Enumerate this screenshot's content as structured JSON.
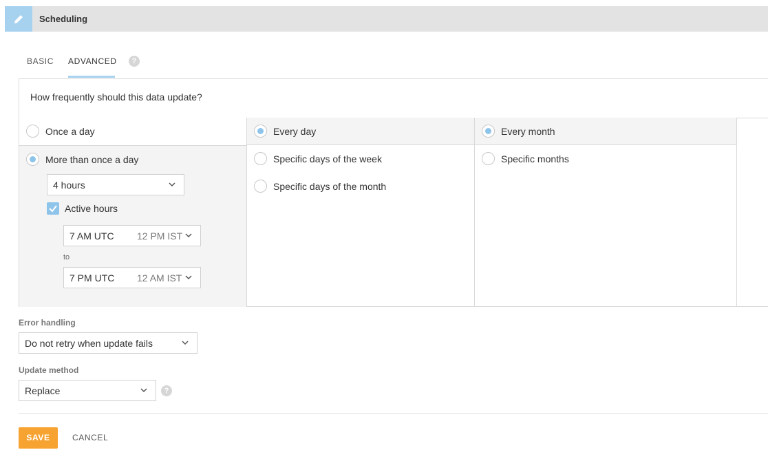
{
  "header": {
    "title": "Scheduling",
    "icon": "pencil-icon",
    "accent": "#a7d2ef"
  },
  "tabs": [
    {
      "label": "BASIC",
      "active": false
    },
    {
      "label": "ADVANCED",
      "active": true
    }
  ],
  "frequency": {
    "question": "How frequently should this data update?",
    "daily_options": [
      {
        "label": "Once a day",
        "selected": false
      },
      {
        "label": "More than once a day",
        "selected": true
      }
    ],
    "interval": {
      "value": "4 hours"
    },
    "active_hours": {
      "label": "Active hours",
      "checked": true,
      "from": {
        "utc": "7 AM UTC",
        "local": "12 PM IST"
      },
      "separator": "to",
      "to": {
        "utc": "7 PM UTC",
        "local": "12 AM IST"
      }
    },
    "day_options": [
      {
        "label": "Every day",
        "selected": true
      },
      {
        "label": "Specific days of the week",
        "selected": false
      },
      {
        "label": "Specific days of the month",
        "selected": false
      }
    ],
    "month_options": [
      {
        "label": "Every month",
        "selected": true
      },
      {
        "label": "Specific months",
        "selected": false
      }
    ]
  },
  "error_handling": {
    "label": "Error handling",
    "value": "Do not retry when update fails"
  },
  "update_method": {
    "label": "Update method",
    "value": "Replace"
  },
  "actions": {
    "save": "SAVE",
    "cancel": "CANCEL",
    "save_color": "#f7a331"
  },
  "help_glyph": "?"
}
